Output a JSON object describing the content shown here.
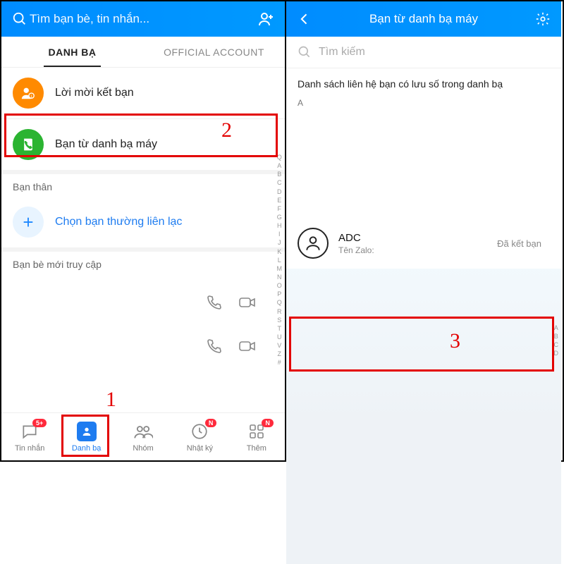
{
  "left": {
    "search_placeholder": "Tìm bạn bè, tin nhắn...",
    "tabs": {
      "contacts": "DANH BẠ",
      "official": "OFFICIAL ACCOUNT"
    },
    "rows": {
      "friend_requests": "Lời mời kết bạn",
      "phone_contacts": "Bạn từ danh bạ máy"
    },
    "section_close": "Bạn thân",
    "choose_frequent": "Chọn bạn thường liên lạc",
    "section_recent": "Bạn bè mới truy cập",
    "alpha": [
      "Q",
      "A",
      "B",
      "C",
      "D",
      "E",
      "F",
      "G",
      "H",
      "I",
      "J",
      "K",
      "L",
      "M",
      "N",
      "O",
      "P",
      "Q",
      "R",
      "S",
      "T",
      "U",
      "V",
      "Z",
      "#"
    ],
    "nav": {
      "messages": "Tin nhắn",
      "messages_badge": "5+",
      "contacts": "Danh bạ",
      "groups": "Nhóm",
      "timeline": "Nhật ký",
      "timeline_badge": "N",
      "more": "Thêm",
      "more_badge": "N"
    }
  },
  "right": {
    "title": "Bạn từ danh bạ máy",
    "search_placeholder": "Tìm kiếm",
    "headline": "Danh sách liên hệ bạn có lưu số trong danh bạ",
    "section_letter": "A",
    "contact": {
      "name": "ADC",
      "sub": "Tên Zalo:",
      "status": "Đã kết bạn"
    },
    "alpha": [
      "A",
      "B",
      "C",
      "D"
    ]
  },
  "annotations": {
    "n1": "1",
    "n2": "2",
    "n3": "3"
  }
}
